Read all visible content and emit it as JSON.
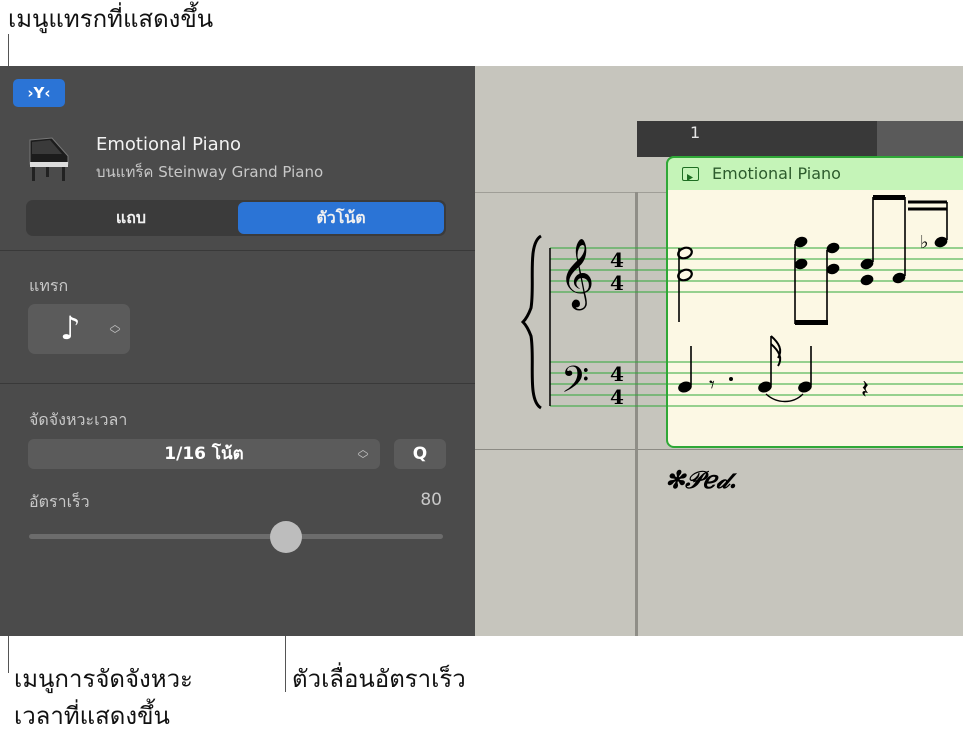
{
  "callouts": {
    "insert_menu": "เมนูแทรกที่แสดงขึ้น",
    "quantize_menu_line1": "เมนูการจัดจังหวะ",
    "quantize_menu_line2": "เวลาที่แสดงขึ้น",
    "velocity_slider": "ตัวเลื่อนอัตราเร็ว"
  },
  "toolbar": {
    "smart_controls_label": "›Y‹"
  },
  "track": {
    "name": "Emotional Piano",
    "subtitle": "บนแทร็ค Steinway Grand Piano",
    "icon": "grand-piano-icon"
  },
  "segmented": {
    "region_label": "แถบ",
    "notes_label": "ตัวโน้ต",
    "selected": "notes"
  },
  "insert": {
    "label": "แทรก",
    "value_glyph": "♪"
  },
  "quantize": {
    "label": "จัดจังหวะเวลา",
    "value": "1/16 โน้ต",
    "q_button": "Q"
  },
  "velocity": {
    "label": "อัตราเร็ว",
    "value": "80",
    "level": 0.62
  },
  "score": {
    "bar_number": "1",
    "region_name": "Emotional Piano",
    "pedal_marking": "✻𝒫ℯ𝒹.",
    "time_signature_top": "4",
    "time_signature_bottom": "4"
  },
  "colors": {
    "accent": "#2b74d6",
    "panel": "#4b4b4b",
    "region_border": "#2fa837",
    "region_header": "#c5f4b8",
    "region_body": "#fcf8e4"
  }
}
